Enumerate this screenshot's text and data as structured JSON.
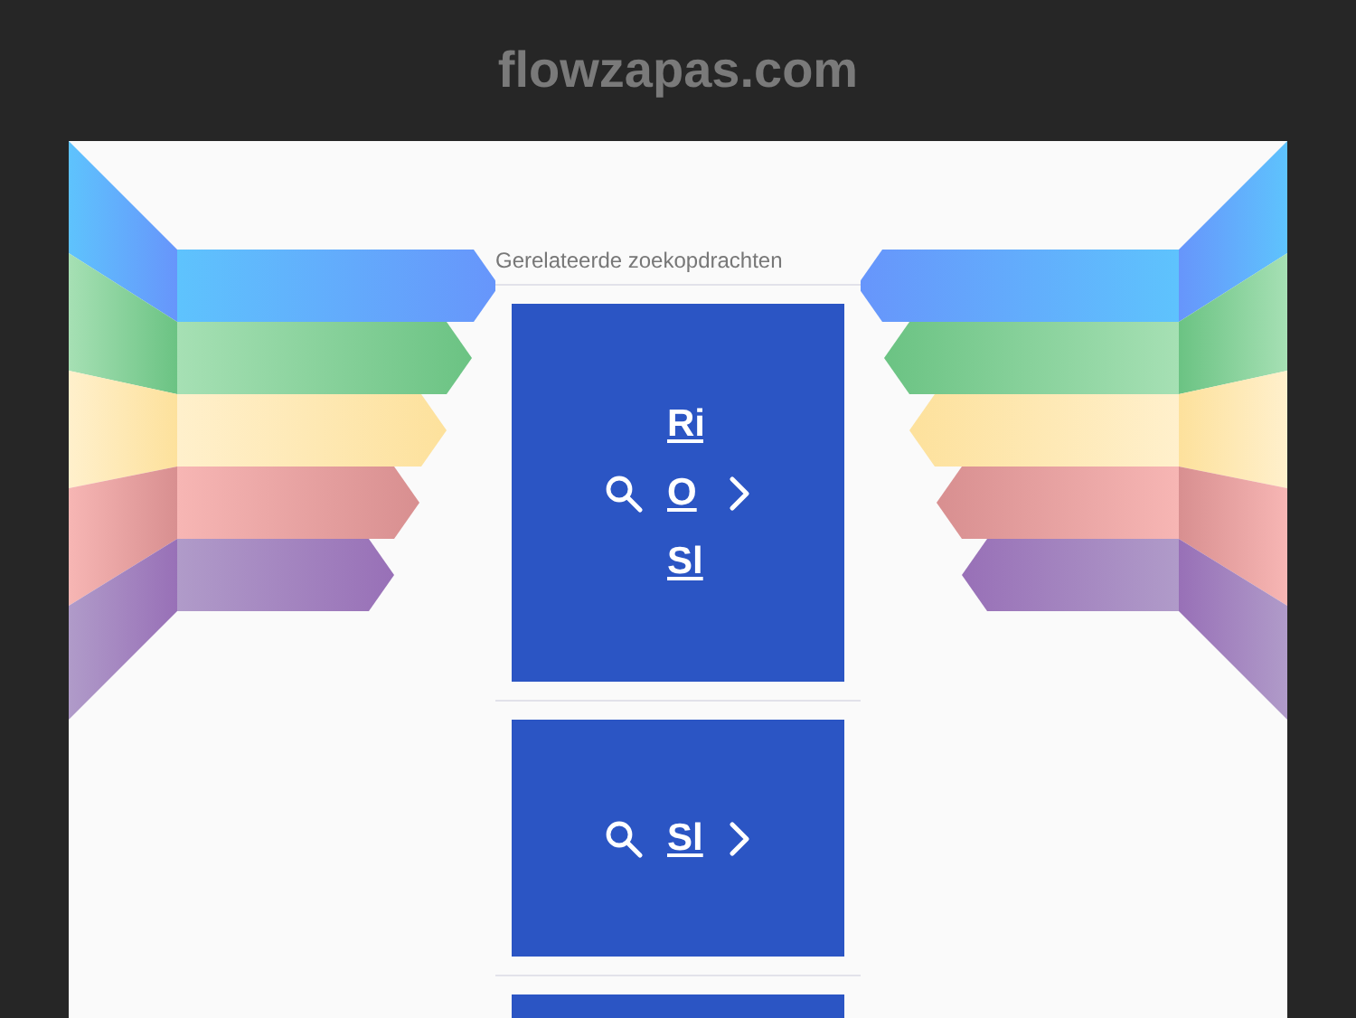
{
  "site": {
    "title": "flowzapas.com"
  },
  "related": {
    "heading": "Gerelateerde zoekopdrachten",
    "cards": [
      {
        "links": [
          "Ri",
          "O",
          "Sl"
        ]
      },
      {
        "links": [
          "Sl"
        ]
      }
    ]
  }
}
